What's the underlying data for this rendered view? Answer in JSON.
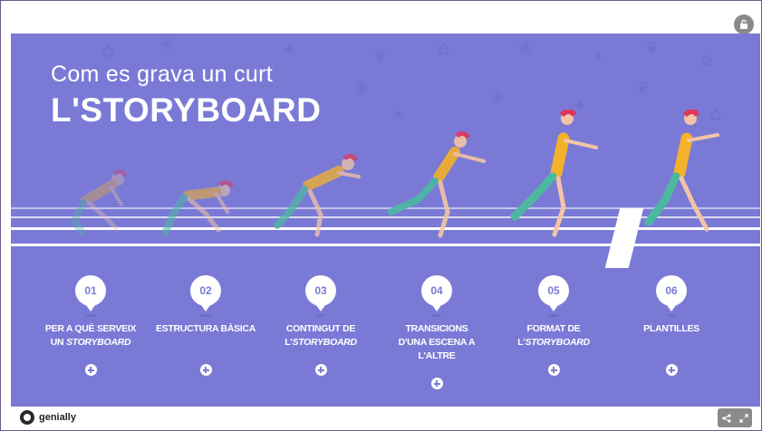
{
  "header": {
    "lock_icon": "lock-icon"
  },
  "slide": {
    "subtitle": "Com es grava un curt",
    "title": "L'STORYBOARD"
  },
  "nav": [
    {
      "number": "01",
      "line1": "PER A QUÈ SERVEIX",
      "line2_plain": "UN ",
      "line2_italic": "STORYBOARD"
    },
    {
      "number": "02",
      "line1": "ESTRUCTURA BÀSICA",
      "line2_plain": "",
      "line2_italic": ""
    },
    {
      "number": "03",
      "line1": "CONTINGUT DE",
      "line2_plain": "L'",
      "line2_italic": "STORYBOARD"
    },
    {
      "number": "04",
      "line1": "TRANSICIONS",
      "line2_plain": "D'UNA ESCENA A L'ALTRE",
      "line2_italic": ""
    },
    {
      "number": "05",
      "line1": "FORMAT DE",
      "line2_plain": "L'",
      "line2_italic": "STORYBOARD"
    },
    {
      "number": "06",
      "line1": "PLANTILLES",
      "line2_plain": "",
      "line2_italic": ""
    }
  ],
  "footer": {
    "brand": "genially",
    "share_icon": "share-icon",
    "fullscreen_icon": "fullscreen-icon"
  },
  "colors": {
    "background": "#7a7ad6",
    "runner_shirt": "#f4b12a",
    "runner_shorts": "#4db8a0",
    "runner_hair": "#e0365a",
    "skin": "#f3c4a6"
  }
}
